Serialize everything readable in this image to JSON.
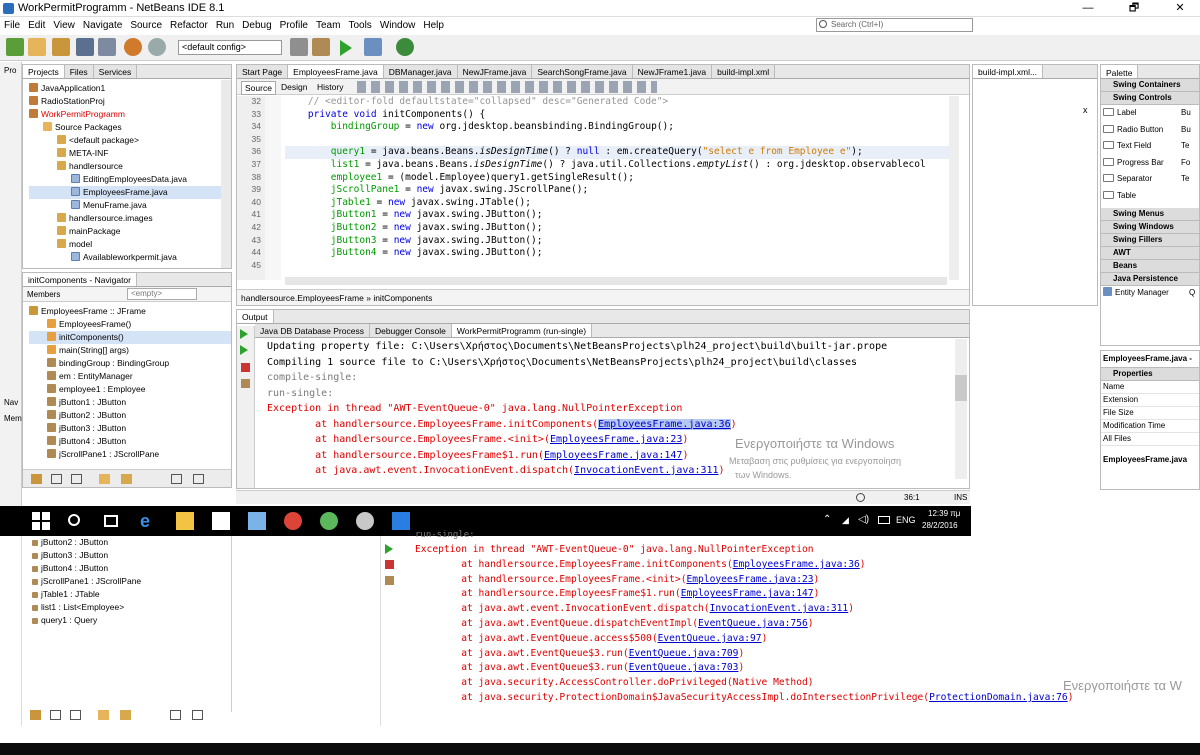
{
  "window": {
    "title": "WorkPermitProgramm - NetBeans IDE 8.1",
    "min": "—",
    "max": "🗗",
    "close": "✕"
  },
  "menu": [
    "File",
    "Edit",
    "View",
    "Navigate",
    "Source",
    "Refactor",
    "Run",
    "Debug",
    "Profile",
    "Team",
    "Tools",
    "Window",
    "Help"
  ],
  "search": {
    "placeholder": "Search (Ctrl+I)"
  },
  "toolbar": {
    "config": "<default config>"
  },
  "projects": {
    "tabs": [
      "Projects",
      "Files",
      "Services"
    ],
    "side_tab": "Pro",
    "items": [
      {
        "label": "JavaApplication1",
        "indent": 0,
        "icon": "proj"
      },
      {
        "label": "RadioStationProj",
        "indent": 0,
        "icon": "proj"
      },
      {
        "label": "WorkPermitProgramm",
        "indent": 0,
        "icon": "proj",
        "red": true
      },
      {
        "label": "Source Packages",
        "indent": 1,
        "icon": "fold"
      },
      {
        "label": "<default package>",
        "indent": 2,
        "icon": "pkg"
      },
      {
        "label": "META-INF",
        "indent": 2,
        "icon": "pkg"
      },
      {
        "label": "handlersource",
        "indent": 2,
        "icon": "pkg"
      },
      {
        "label": "EditingEmployeesData.java",
        "indent": 3,
        "icon": "java"
      },
      {
        "label": "EmployeesFrame.java",
        "indent": 3,
        "icon": "java",
        "selected": true
      },
      {
        "label": "MenuFrame.java",
        "indent": 3,
        "icon": "java"
      },
      {
        "label": "handlersource.images",
        "indent": 2,
        "icon": "pkg"
      },
      {
        "label": "mainPackage",
        "indent": 2,
        "icon": "pkg"
      },
      {
        "label": "model",
        "indent": 2,
        "icon": "pkg"
      },
      {
        "label": "Availableworkpermit.java",
        "indent": 3,
        "icon": "java"
      }
    ]
  },
  "navigator": {
    "title": "initComponents - Navigator",
    "filter_label": "Members",
    "filter_value": "<empty>",
    "items": [
      {
        "label": "EmployeesFrame :: JFrame",
        "indent": 0
      },
      {
        "label": "EmployeesFrame()",
        "indent": 1
      },
      {
        "label": "initComponents()",
        "indent": 1,
        "selected": true
      },
      {
        "label": "main(String[] args)",
        "indent": 1
      },
      {
        "label": "bindingGroup : BindingGroup",
        "indent": 1
      },
      {
        "label": "em : EntityManager",
        "indent": 1
      },
      {
        "label": "employee1 : Employee",
        "indent": 1
      },
      {
        "label": "jButton1 : JButton",
        "indent": 1
      },
      {
        "label": "jButton2 : JButton",
        "indent": 1
      },
      {
        "label": "jButton3 : JButton",
        "indent": 1
      },
      {
        "label": "jButton4 : JButton",
        "indent": 1
      },
      {
        "label": "jScrollPane1 : JScrollPane",
        "indent": 1
      }
    ],
    "side_tabs": [
      "Nav",
      "Mem"
    ]
  },
  "editor": {
    "tabs": [
      "Start Page",
      "EmployeesFrame.java",
      "DBManager.java",
      "NewJFrame.java",
      "SearchSongFrame.java",
      "NewJFrame1.java",
      "build-impl.xml"
    ],
    "active_tab": 1,
    "modes": [
      "Source",
      "Design",
      "History"
    ],
    "lines": [
      {
        "n": "32",
        "t": "    // <editor-fold defaultstate=\"collapsed\" desc=\"Generated Code\">"
      },
      {
        "n": "33",
        "t": "    private void initComponents() {"
      },
      {
        "n": "34",
        "t": "        bindingGroup = new org.jdesktop.beansbinding.BindingGroup();"
      },
      {
        "n": "35",
        "t": ""
      },
      {
        "n": "36",
        "t": "        query1 = java.beans.Beans.isDesignTime() ? null : em.createQuery(\"select e from Employee e\");"
      },
      {
        "n": "37",
        "t": "        list1 = java.beans.Beans.isDesignTime() ? java.util.Collections.emptyList() : org.jdesktop.observablecol"
      },
      {
        "n": "38",
        "t": "        employee1 = (model.Employee)query1.getSingleResult();"
      },
      {
        "n": "39",
        "t": "        jScrollPane1 = new javax.swing.JScrollPane();"
      },
      {
        "n": "40",
        "t": "        jTable1 = new javax.swing.JTable();"
      },
      {
        "n": "41",
        "t": "        jButton1 = new javax.swing.JButton();"
      },
      {
        "n": "42",
        "t": "        jButton2 = new javax.swing.JButton();"
      },
      {
        "n": "43",
        "t": "        jButton3 = new javax.swing.JButton();"
      },
      {
        "n": "44",
        "t": "        jButton4 = new javax.swing.JButton();"
      },
      {
        "n": "45",
        "t": ""
      }
    ],
    "breadcrumb": [
      "handlersource.EmployeesFrame",
      "initComponents"
    ]
  },
  "output": {
    "title": "Output",
    "tabs": [
      "Java DB Database Process",
      "Debugger Console",
      "WorkPermitProgramm (run-single)"
    ],
    "lines": [
      {
        "t": "Updating property file: C:\\Users\\Χρήστος\\Documents\\NetBeansProjects\\plh24_project\\build\\built-jar.prope",
        "c": ""
      },
      {
        "t": "Compiling 1 source file to C:\\Users\\Χρήστος\\Documents\\NetBeansProjects\\plh24_project\\build\\classes",
        "c": ""
      },
      {
        "t": "compile-single:",
        "c": "gray"
      },
      {
        "t": "run-single:",
        "c": "gray"
      },
      {
        "t": "Exception in thread \"AWT-EventQueue-0\" java.lang.NullPointerException",
        "c": "red"
      },
      {
        "t": "        at handlersource.EmployeesFrame.initComponents(",
        "l": "EmployeesFrame.java:36",
        "e": ")",
        "c": "red",
        "hl": true
      },
      {
        "t": "        at handlersource.EmployeesFrame.<init>(",
        "l": "EmployeesFrame.java:23",
        "e": ")",
        "c": "red"
      },
      {
        "t": "        at handlersource.EmployeesFrame$1.run(",
        "l": "EmployeesFrame.java:147",
        "e": ")",
        "c": "red"
      },
      {
        "t": "        at java.awt.event.InvocationEvent.dispatch(",
        "l": "InvocationEvent.java:311",
        "e": ")",
        "c": "red"
      }
    ],
    "watermark1": "Ενεργοποιήστε τα Windows",
    "watermark2": "Μεταβαση στις ρυθμίσεις για ενεργοποίηση",
    "watermark3": "των Windows."
  },
  "status": {
    "pos": "36:1",
    "mode": "INS"
  },
  "palette": {
    "title": "Palette",
    "groups_top": [
      "Swing Containers",
      "Swing Controls"
    ],
    "controls": [
      [
        "Label",
        "Bu"
      ],
      [
        "Radio Button",
        "Bu"
      ],
      [
        "Text Field",
        "Te"
      ],
      [
        "Progress Bar",
        "Fo"
      ],
      [
        "Separator",
        "Te"
      ],
      [
        "Table",
        ""
      ]
    ],
    "groups_bottom": [
      "Swing Menus",
      "Swing Windows",
      "Swing Fillers",
      "AWT",
      "Beans",
      "Java Persistence"
    ],
    "persist": [
      "Entity Manager",
      "Q"
    ]
  },
  "properties": {
    "title": "EmployeesFrame.java -",
    "section": "Properties",
    "rows": [
      "Name",
      "Extension",
      "File Size",
      "Modification Time",
      "All Files"
    ],
    "footer": "EmployeesFrame.java"
  },
  "mini_tab": {
    "label": "build-impl.xml..."
  },
  "taskbar": {
    "lang": "ENG",
    "time": "12:39 πμ",
    "date": "28/2/2016"
  },
  "bg_nav": {
    "items": [
      "jButton2 : JButton",
      "jButton3 : JButton",
      "jButton4 : JButton",
      "jScrollPane1 : JScrollPane",
      "jTable1 : JTable",
      "list1 : List<Employee>",
      "query1 : Query"
    ]
  },
  "bg_output": {
    "top": "run-single:",
    "lines": [
      {
        "t": "Exception in thread \"AWT-EventQueue-0\" java.lang.NullPointerException",
        "l": "",
        "e": ""
      },
      {
        "t": "        at handlersource.EmployeesFrame.initComponents(",
        "l": "EmployeesFrame.java:36",
        "e": ")"
      },
      {
        "t": "        at handlersource.EmployeesFrame.<init>(",
        "l": "EmployeesFrame.java:23",
        "e": ")"
      },
      {
        "t": "        at handlersource.EmployeesFrame$1.run(",
        "l": "EmployeesFrame.java:147",
        "e": ")"
      },
      {
        "t": "        at java.awt.event.InvocationEvent.dispatch(",
        "l": "InvocationEvent.java:311",
        "e": ")"
      },
      {
        "t": "        at java.awt.EventQueue.dispatchEventImpl(",
        "l": "EventQueue.java:756",
        "e": ")"
      },
      {
        "t": "        at java.awt.EventQueue.access$500(",
        "l": "EventQueue.java:97",
        "e": ")"
      },
      {
        "t": "        at java.awt.EventQueue$3.run(",
        "l": "EventQueue.java:709",
        "e": ")"
      },
      {
        "t": "        at java.awt.EventQueue$3.run(",
        "l": "EventQueue.java:703",
        "e": ")"
      },
      {
        "t": "        at java.security.AccessController.doPrivileged(Native Method)",
        "l": "",
        "e": ""
      },
      {
        "t": "        at java.security.ProtectionDomain$JavaSecurityAccessImpl.doIntersectionPrivilege(",
        "l": "ProtectionDomain.java:76",
        "e": ")"
      }
    ],
    "watermark": "Ενεργοποιήστε τα W"
  }
}
